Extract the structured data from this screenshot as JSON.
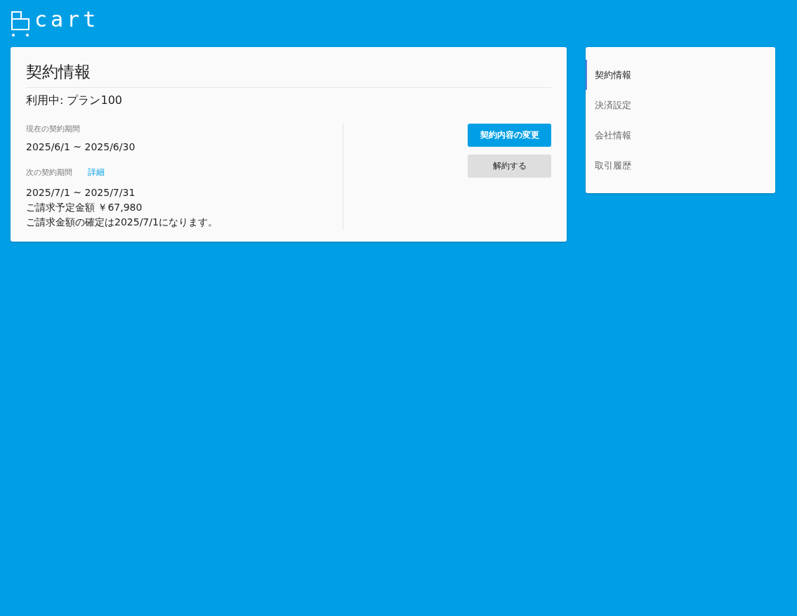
{
  "logo": {
    "text": "cart"
  },
  "contract": {
    "title": "契約情報",
    "plan": "利用中: プラン100",
    "current": {
      "label": "現在の契約期間",
      "period": "2025/6/1 ~ 2025/6/30"
    },
    "next": {
      "label": "次の契約期間",
      "link": "詳細",
      "period": "2025/7/1 ~ 2025/7/31",
      "amount": "ご請求予定金額 ￥67,980",
      "note": "ご請求金額の確定は2025/7/1になります。"
    },
    "buttons": [
      {
        "label": "契約内容の変更",
        "kind": "primary"
      },
      {
        "label": "解約する",
        "kind": "secondary"
      }
    ]
  },
  "sidebar": {
    "items": [
      {
        "label": "契約情報",
        "selected": true
      },
      {
        "label": "決済設定",
        "selected": false
      },
      {
        "label": "会社情報",
        "selected": false
      },
      {
        "label": "取引履歴",
        "selected": false
      }
    ]
  }
}
